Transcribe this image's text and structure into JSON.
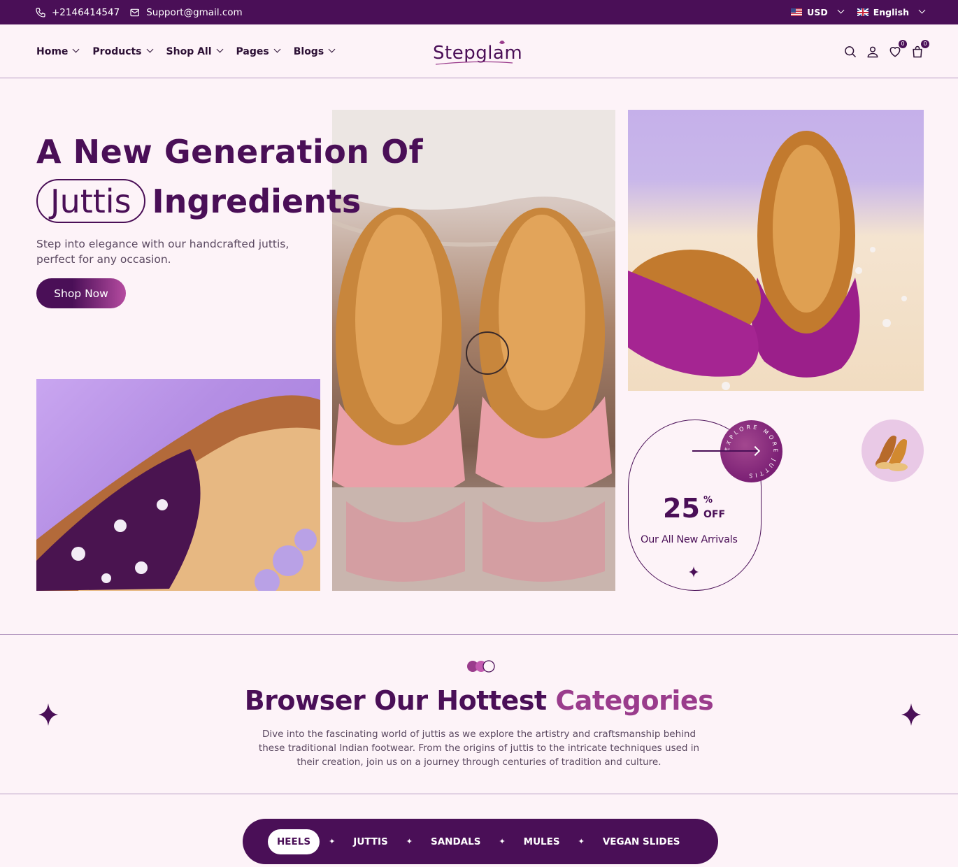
{
  "topbar": {
    "phone": "+2146414547",
    "email": "Support@gmail.com",
    "currency": "USD",
    "language": "English"
  },
  "nav": {
    "items": [
      "Home",
      "Products",
      "Shop All",
      "Pages",
      "Blogs"
    ],
    "logo": "Stepglam",
    "wishlist_count": "0",
    "cart_count": "0"
  },
  "hero": {
    "title_line1": "A New Generation Of",
    "title_pill": "Juttis",
    "title_line2_rest": "Ingredients",
    "subtitle": "Step into elegance with our handcrafted juttis, perfect for any occasion.",
    "cta": "Shop Now"
  },
  "promo": {
    "value": "25",
    "percent": "%",
    "off": "OFF",
    "text": "Our All New Arrivals",
    "circle_text": "EXPLORE MORE JUTTIS"
  },
  "categories": {
    "title_main": "Browser Our Hottest",
    "title_accent": "Categories",
    "description": "Dive into the fascinating world of juttis as we explore the artistry and craftsmanship behind these traditional Indian footwear. From the origins of juttis to the intricate techniques used in their creation, join us on a journey through centuries of tradition and culture.",
    "tabs": [
      "HEELS",
      "JUTTIS",
      "SANDALS",
      "MULES",
      "VEGAN SLIDES"
    ],
    "active_tab": "HEELS"
  },
  "colors": {
    "primary": "#4a0f57",
    "accent": "#9a3c8c",
    "background": "#fdf3f8"
  }
}
